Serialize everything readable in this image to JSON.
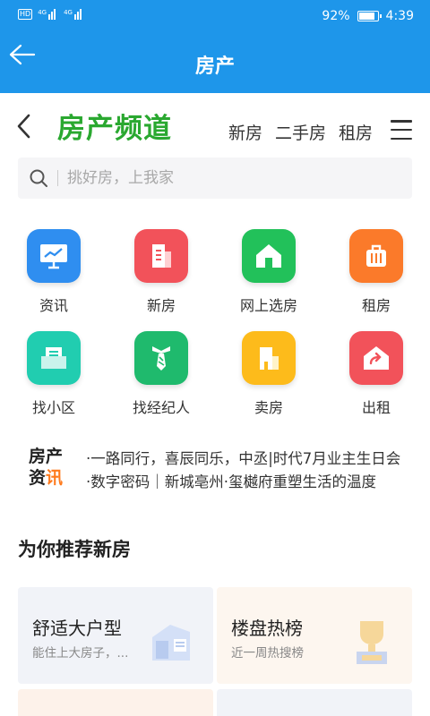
{
  "status": {
    "hd_badge": "HD",
    "signal1": "4G",
    "signal2": "4G",
    "battery_text": "92%",
    "battery_level": 0.92,
    "time": "4:39"
  },
  "appbar": {
    "title": "房产"
  },
  "channel": {
    "title": "房产频道",
    "tabs": [
      "新房",
      "二手房",
      "租房"
    ]
  },
  "search": {
    "placeholder": "挑好房，上我家"
  },
  "grid": [
    {
      "label": "资讯",
      "icon": "news-chart-icon",
      "color": "#2f8ef0"
    },
    {
      "label": "新房",
      "icon": "new-building-icon",
      "color": "#f2525a"
    },
    {
      "label": "网上选房",
      "icon": "house-select-icon",
      "color": "#22c15a"
    },
    {
      "label": "租房",
      "icon": "suitcase-icon",
      "color": "#fb7a2a"
    },
    {
      "label": "找小区",
      "icon": "community-icon",
      "color": "#21cdb0"
    },
    {
      "label": "找经纪人",
      "icon": "agent-tie-icon",
      "color": "#1fba6d"
    },
    {
      "label": "卖房",
      "icon": "sell-house-icon",
      "color": "#fdbb1b"
    },
    {
      "label": "出租",
      "icon": "rent-out-icon",
      "color": "#f2525a"
    }
  ],
  "news": {
    "tag_line1": "房产",
    "tag_line2_a": "资",
    "tag_line2_b": "讯",
    "items": [
      "·一路同行，喜辰同乐，中丞|时代7月业主生日会",
      "·数字密码｜新城亳州·玺樾府重塑生活的温度"
    ]
  },
  "recommend": {
    "title": "为你推荐新房",
    "cards": [
      {
        "title": "舒适大户型",
        "subtitle": "能住上大房子，...",
        "bg": "#f1f3f8"
      },
      {
        "title": "楼盘热榜",
        "subtitle": "近一周热搜榜",
        "bg": "#fdf6ef"
      }
    ]
  }
}
